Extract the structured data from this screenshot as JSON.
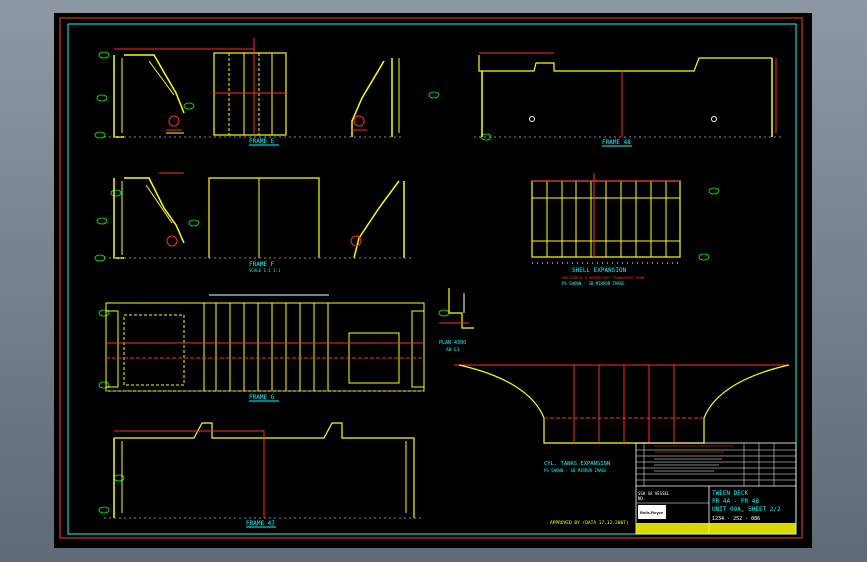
{
  "drawing": {
    "frames": {
      "frame_e": "FRAME E",
      "frame_f": "FRAME F",
      "frame_f_sub": "SCALE 1:1 1:1",
      "frame_g": "FRAME G",
      "frame_47": "FRAME 47",
      "frame_48": "FRAME 48"
    },
    "shell_expansion": {
      "title": "SHELL EXPANSION",
      "note1": "HORIZONTAL & WATERTIGHT TRANSVERSE SEAM",
      "note2": "PS SHOWN - SB MIRROR IMAGE"
    },
    "plan": {
      "title": "PLAN 4300",
      "sub": "AB-E1"
    },
    "cyl_tanks": {
      "title": "CYL. TANKS EXPANSION",
      "note": "PS SHOWN - SB MIRROR IMAGE"
    },
    "approval": "APPROVED BY (DATA 17.12.2007)",
    "title_block": {
      "line1": "TWEEN DECK",
      "line2": "FR 4A - FR 48",
      "line3": "UNIT 09A, SHEET 2/2",
      "company_left_1": "SSH SA   VESSEL",
      "company_left_2": "NO.",
      "logo": "Rolls-Royce",
      "drawing_no": "1234 - 252 - 086"
    },
    "colors": {
      "frame_line": "#ffff00",
      "dimension": "#ff2a2a",
      "annotation": "#00ff00",
      "border": "#00ffff",
      "text": "#ffffff"
    }
  }
}
